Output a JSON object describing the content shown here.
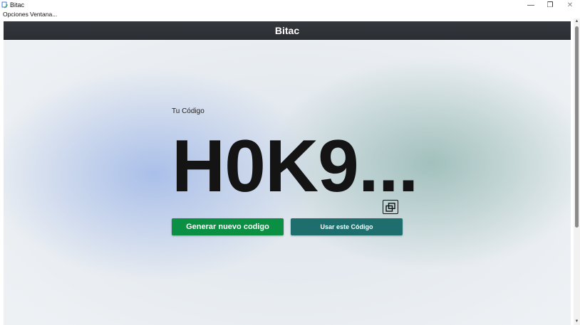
{
  "window": {
    "title": "Bitac",
    "minimize_icon": "minimize-icon",
    "maximize_icon": "restore-icon",
    "close_icon": "close-icon",
    "minimize_glyph": "—",
    "maximize_glyph": "❐",
    "close_glyph": "✕"
  },
  "menubar": {
    "items": [
      {
        "label": "Opciones"
      },
      {
        "label": "Ventana..."
      }
    ]
  },
  "header": {
    "title": "Bitac",
    "background": "#2f3237"
  },
  "code_panel": {
    "label": "Tu Código",
    "value": "H0K9...",
    "copy_icon": "copy-icon"
  },
  "actions": {
    "generate_label": "Generar nuevo codigo",
    "use_label": "Usar este Código",
    "generate_color": "#0a8f43",
    "use_color": "#1e6e6e"
  },
  "scrollbar": {
    "up_icon": "chevron-up-icon",
    "down_icon": "chevron-down-icon",
    "up_glyph": "▲",
    "down_glyph": "▼"
  }
}
